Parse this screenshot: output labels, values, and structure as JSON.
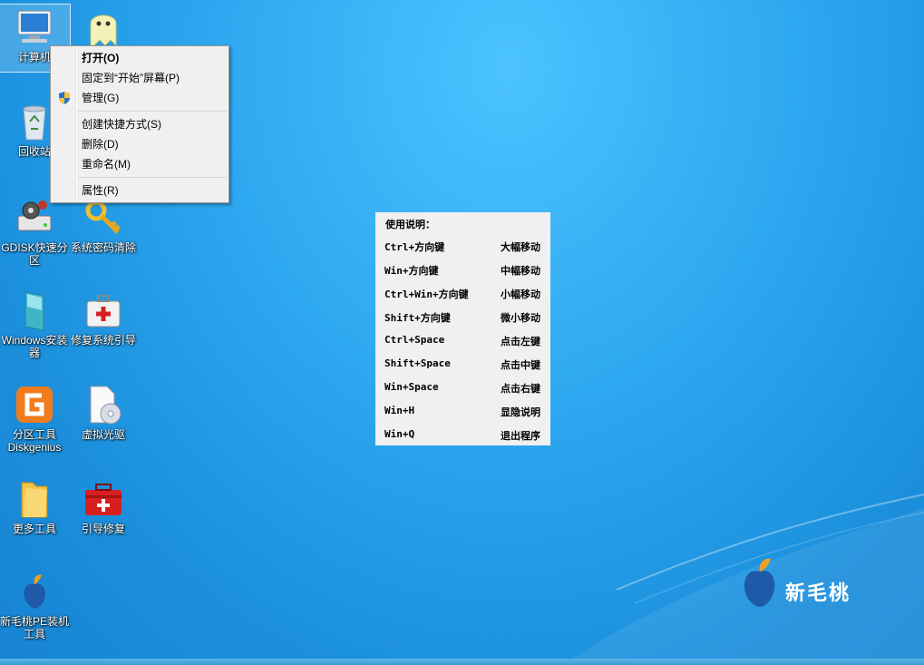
{
  "desktop": {
    "icons": [
      {
        "label": "计算机",
        "icon": "computer-icon"
      },
      {
        "label": "",
        "icon": "ghost-icon"
      },
      {
        "label": "回收站",
        "icon": "recycle-bin-icon"
      },
      {
        "label": "GDISK快速分区",
        "icon": "disk-gear-icon"
      },
      {
        "label": "系统密码清除",
        "icon": "key-icon"
      },
      {
        "label": "Windows安装器",
        "icon": "windows-installer-icon"
      },
      {
        "label": "修复系统引导",
        "icon": "first-aid-box-icon"
      },
      {
        "label": "分区工具Diskgenius",
        "icon": "diskgenius-icon"
      },
      {
        "label": "虚拟光驱",
        "icon": "virtual-cd-icon"
      },
      {
        "label": "更多工具",
        "icon": "folder-icon"
      },
      {
        "label": "引导修复",
        "icon": "red-toolbox-icon"
      },
      {
        "label": "新毛桃PE装机工具",
        "icon": "peach-logo-icon"
      }
    ]
  },
  "context_menu": {
    "items": [
      {
        "label": "打开(O)",
        "bold": true
      },
      {
        "label": "固定到“开始”屏幕(P)"
      },
      {
        "label": "管理(G)",
        "icon": "uac-shield-icon"
      },
      {
        "label": "创建快捷方式(S)"
      },
      {
        "label": "删除(D)"
      },
      {
        "label": "重命名(M)"
      },
      {
        "label": "属性(R)"
      }
    ]
  },
  "help_panel": {
    "title": "使用说明：",
    "rows": [
      {
        "key": "Ctrl+方向键",
        "desc": "大幅移动"
      },
      {
        "key": "Win+方向键",
        "desc": "中幅移动"
      },
      {
        "key": "Ctrl+Win+方向键",
        "desc": "小幅移动"
      },
      {
        "key": "Shift+方向键",
        "desc": "微小移动"
      },
      {
        "key": "Ctrl+Space",
        "desc": "点击左键"
      },
      {
        "key": "Shift+Space",
        "desc": "点击中键"
      },
      {
        "key": "Win+Space",
        "desc": "点击右键"
      },
      {
        "key": "Win+H",
        "desc": "显隐说明"
      },
      {
        "key": "Win+Q",
        "desc": "退出程序"
      }
    ]
  },
  "brand": {
    "name": "新毛桃",
    "color": "#1e5aa8"
  }
}
